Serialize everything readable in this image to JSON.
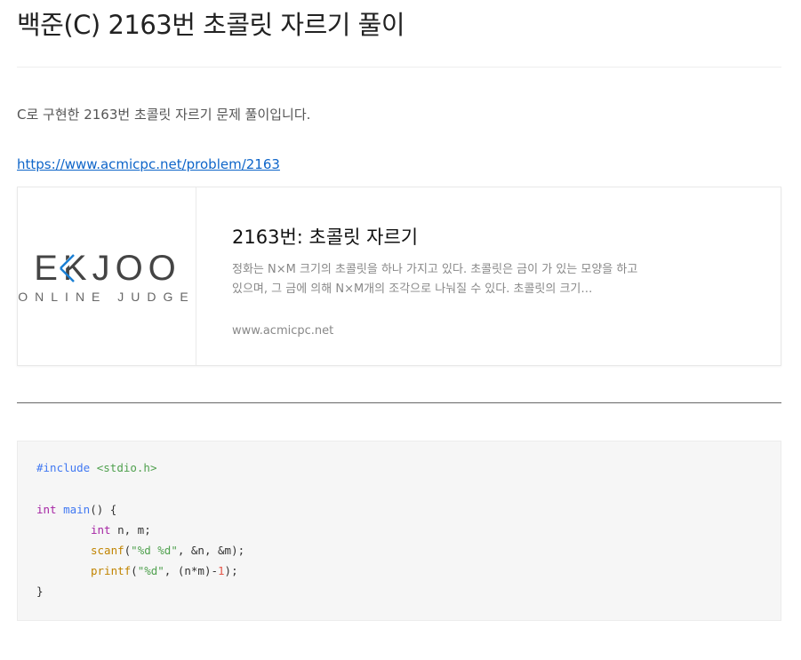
{
  "post": {
    "title": "백준(C) 2163번 초콜릿 자르기 풀이",
    "intro": "C로 구현한 2163번 초콜릿 자르기 문제 풀이입니다.",
    "link": "https://www.acmicpc.net/problem/2163"
  },
  "card": {
    "logo_main": "EKJOO",
    "logo_sub": "ONLINE JUDGE",
    "title": "2163번: 초콜릿 자르기",
    "description": "정화는 N×M 크기의 초콜릿을 하나 가지고 있다. 초콜릿은 금이 가 있는 모양을 하고 있으며, 그 금에 의해 N×M개의 조각으로 나눠질 수 있다. 초콜릿의 크기…",
    "domain": "www.acmicpc.net"
  },
  "code": {
    "include_kw": "#include",
    "include_hdr": "<stdio.h>",
    "int1": "int",
    "main_fn": "main",
    "main_rest": "() {",
    "int2": "int",
    "decl_rest": " n, m;",
    "scanf_fn": "scanf",
    "scanf_str": "\"%d %d\"",
    "scanf_rest": ", &n, &m);",
    "printf_fn": "printf",
    "printf_str": "\"%d\"",
    "printf_mid": ", (n*m)-",
    "printf_num": "1",
    "printf_end": ");",
    "close": "}"
  },
  "colors": {
    "link": "#0e65c9",
    "logo_accent": "#1a7fd4",
    "code_keyword": "#a626a4",
    "code_string": "#50a14f",
    "code_function": "#c18401",
    "code_number": "#e45649",
    "code_preprocessor": "#4078f2"
  }
}
